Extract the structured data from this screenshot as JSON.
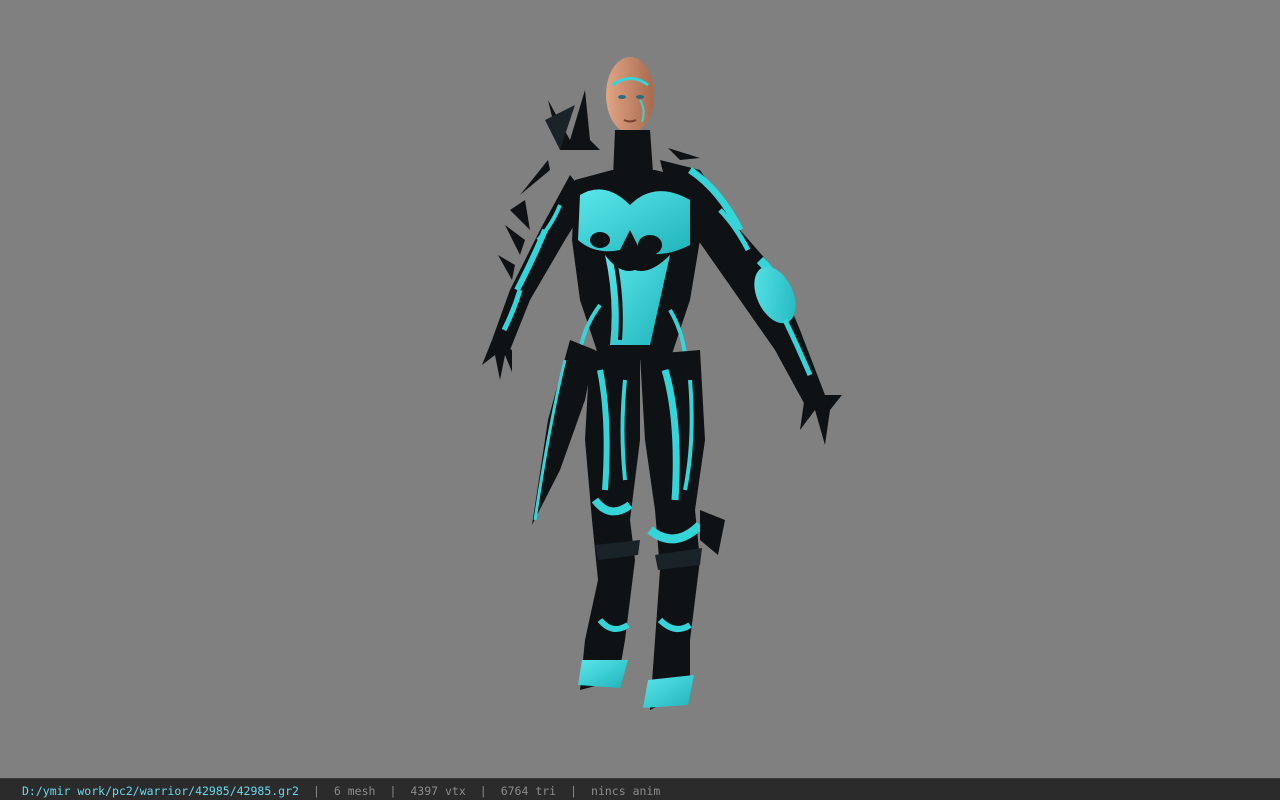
{
  "viewer": {
    "background_color": "#808080",
    "model": {
      "icon": "character-model-icon",
      "armor_color": "#35d4d9",
      "armor_dark_color": "#0f1214",
      "skin_color": "#c88b6a"
    }
  },
  "status_bar": {
    "path": "D:/ymir work/pc2/warrior/42985/42985.gr2",
    "separator": "|",
    "mesh": "6 mesh",
    "vtx": "4397 vtx",
    "tri": "6764 tri",
    "anim": "nincs anim",
    "path_color": "#67d9ef",
    "text_color": "#8c8c8c"
  }
}
